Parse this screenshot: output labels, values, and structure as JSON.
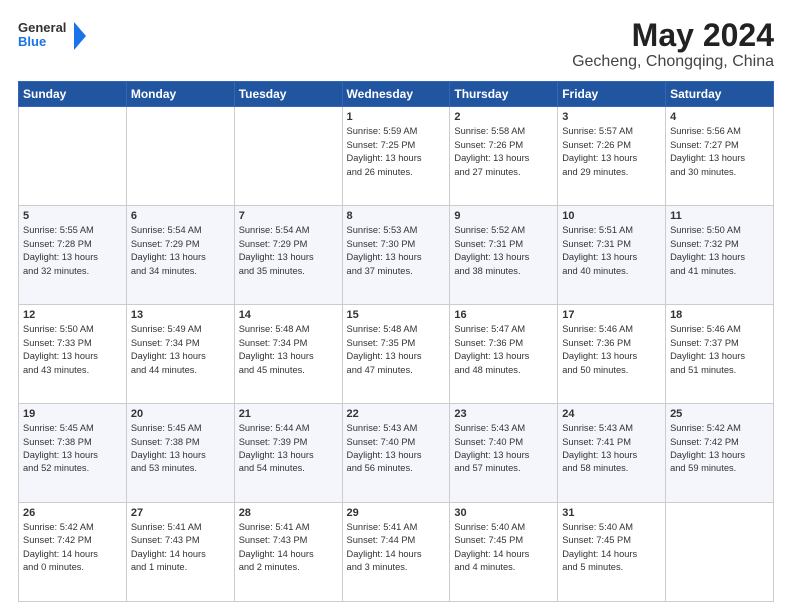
{
  "header": {
    "logo_line1": "General",
    "logo_line2": "Blue",
    "month": "May 2024",
    "location": "Gecheng, Chongqing, China"
  },
  "weekdays": [
    "Sunday",
    "Monday",
    "Tuesday",
    "Wednesday",
    "Thursday",
    "Friday",
    "Saturday"
  ],
  "weeks": [
    [
      {
        "day": "",
        "text": ""
      },
      {
        "day": "",
        "text": ""
      },
      {
        "day": "",
        "text": ""
      },
      {
        "day": "1",
        "text": "Sunrise: 5:59 AM\nSunset: 7:25 PM\nDaylight: 13 hours\nand 26 minutes."
      },
      {
        "day": "2",
        "text": "Sunrise: 5:58 AM\nSunset: 7:26 PM\nDaylight: 13 hours\nand 27 minutes."
      },
      {
        "day": "3",
        "text": "Sunrise: 5:57 AM\nSunset: 7:26 PM\nDaylight: 13 hours\nand 29 minutes."
      },
      {
        "day": "4",
        "text": "Sunrise: 5:56 AM\nSunset: 7:27 PM\nDaylight: 13 hours\nand 30 minutes."
      }
    ],
    [
      {
        "day": "5",
        "text": "Sunrise: 5:55 AM\nSunset: 7:28 PM\nDaylight: 13 hours\nand 32 minutes."
      },
      {
        "day": "6",
        "text": "Sunrise: 5:54 AM\nSunset: 7:29 PM\nDaylight: 13 hours\nand 34 minutes."
      },
      {
        "day": "7",
        "text": "Sunrise: 5:54 AM\nSunset: 7:29 PM\nDaylight: 13 hours\nand 35 minutes."
      },
      {
        "day": "8",
        "text": "Sunrise: 5:53 AM\nSunset: 7:30 PM\nDaylight: 13 hours\nand 37 minutes."
      },
      {
        "day": "9",
        "text": "Sunrise: 5:52 AM\nSunset: 7:31 PM\nDaylight: 13 hours\nand 38 minutes."
      },
      {
        "day": "10",
        "text": "Sunrise: 5:51 AM\nSunset: 7:31 PM\nDaylight: 13 hours\nand 40 minutes."
      },
      {
        "day": "11",
        "text": "Sunrise: 5:50 AM\nSunset: 7:32 PM\nDaylight: 13 hours\nand 41 minutes."
      }
    ],
    [
      {
        "day": "12",
        "text": "Sunrise: 5:50 AM\nSunset: 7:33 PM\nDaylight: 13 hours\nand 43 minutes."
      },
      {
        "day": "13",
        "text": "Sunrise: 5:49 AM\nSunset: 7:34 PM\nDaylight: 13 hours\nand 44 minutes."
      },
      {
        "day": "14",
        "text": "Sunrise: 5:48 AM\nSunset: 7:34 PM\nDaylight: 13 hours\nand 45 minutes."
      },
      {
        "day": "15",
        "text": "Sunrise: 5:48 AM\nSunset: 7:35 PM\nDaylight: 13 hours\nand 47 minutes."
      },
      {
        "day": "16",
        "text": "Sunrise: 5:47 AM\nSunset: 7:36 PM\nDaylight: 13 hours\nand 48 minutes."
      },
      {
        "day": "17",
        "text": "Sunrise: 5:46 AM\nSunset: 7:36 PM\nDaylight: 13 hours\nand 50 minutes."
      },
      {
        "day": "18",
        "text": "Sunrise: 5:46 AM\nSunset: 7:37 PM\nDaylight: 13 hours\nand 51 minutes."
      }
    ],
    [
      {
        "day": "19",
        "text": "Sunrise: 5:45 AM\nSunset: 7:38 PM\nDaylight: 13 hours\nand 52 minutes."
      },
      {
        "day": "20",
        "text": "Sunrise: 5:45 AM\nSunset: 7:38 PM\nDaylight: 13 hours\nand 53 minutes."
      },
      {
        "day": "21",
        "text": "Sunrise: 5:44 AM\nSunset: 7:39 PM\nDaylight: 13 hours\nand 54 minutes."
      },
      {
        "day": "22",
        "text": "Sunrise: 5:43 AM\nSunset: 7:40 PM\nDaylight: 13 hours\nand 56 minutes."
      },
      {
        "day": "23",
        "text": "Sunrise: 5:43 AM\nSunset: 7:40 PM\nDaylight: 13 hours\nand 57 minutes."
      },
      {
        "day": "24",
        "text": "Sunrise: 5:43 AM\nSunset: 7:41 PM\nDaylight: 13 hours\nand 58 minutes."
      },
      {
        "day": "25",
        "text": "Sunrise: 5:42 AM\nSunset: 7:42 PM\nDaylight: 13 hours\nand 59 minutes."
      }
    ],
    [
      {
        "day": "26",
        "text": "Sunrise: 5:42 AM\nSunset: 7:42 PM\nDaylight: 14 hours\nand 0 minutes."
      },
      {
        "day": "27",
        "text": "Sunrise: 5:41 AM\nSunset: 7:43 PM\nDaylight: 14 hours\nand 1 minute."
      },
      {
        "day": "28",
        "text": "Sunrise: 5:41 AM\nSunset: 7:43 PM\nDaylight: 14 hours\nand 2 minutes."
      },
      {
        "day": "29",
        "text": "Sunrise: 5:41 AM\nSunset: 7:44 PM\nDaylight: 14 hours\nand 3 minutes."
      },
      {
        "day": "30",
        "text": "Sunrise: 5:40 AM\nSunset: 7:45 PM\nDaylight: 14 hours\nand 4 minutes."
      },
      {
        "day": "31",
        "text": "Sunrise: 5:40 AM\nSunset: 7:45 PM\nDaylight: 14 hours\nand 5 minutes."
      },
      {
        "day": "",
        "text": ""
      }
    ]
  ]
}
